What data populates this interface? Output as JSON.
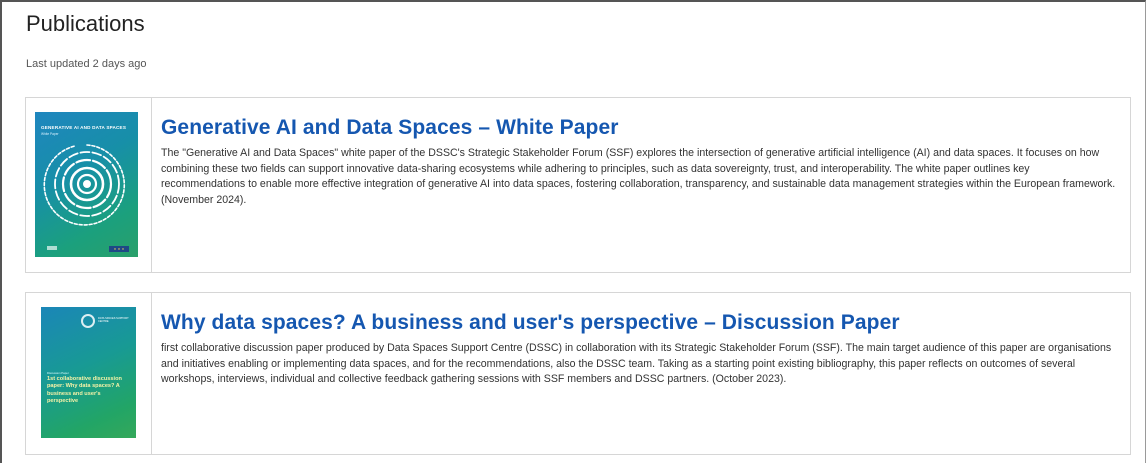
{
  "page": {
    "title": "Publications",
    "last_updated": "Last updated 2 days ago"
  },
  "publications": [
    {
      "title": "Generative AI and Data Spaces – White Paper",
      "description": "The \"Generative AI and Data Spaces\" white paper of the DSSC's Strategic Stakeholder Forum (SSF) explores the intersection of generative artificial intelligence (AI) and data spaces. It focuses on how combining these two fields can support innovative data-sharing ecosystems while adhering to principles, such as data sovereignty, trust, and interoperability. The white paper outlines key recommendations to enable more effective integration of generative AI into data spaces, fostering collaboration, transparency, and sustainable data management strategies within the European framework. (November 2024).",
      "cover": {
        "title": "GENERATIVE AI AND DATA SPACES",
        "subtitle": "White Paper",
        "colors": [
          "#1f86bf",
          "#1ba07d"
        ]
      }
    },
    {
      "title": "Why data spaces? A business and user's perspective – Discussion Paper",
      "description": "first collaborative discussion paper produced by Data Spaces Support Centre (DSSC) in collaboration with its Strategic Stakeholder Forum (SSF). The main target audience of this paper are organisations and initiatives enabling or implementing data spaces, and for the recommendations, also the DSSC team. Taking as a starting point existing bibliography, this paper reflects on outcomes of several workshops, interviews, individual and collective feedback gathering sessions with SSF members and DSSC partners. (October 2023).",
      "cover": {
        "logo_text": "DATA SPACES SUPPORT CENTRE",
        "small_text": "Discussion Paper",
        "title": "1st collaborative discussion paper: Why data spaces? A business and user's perspective",
        "colors": [
          "#1b86b8",
          "#35a85a"
        ]
      }
    }
  ],
  "colors": {
    "link": "#1557b0",
    "border": "#d6d6d6"
  }
}
